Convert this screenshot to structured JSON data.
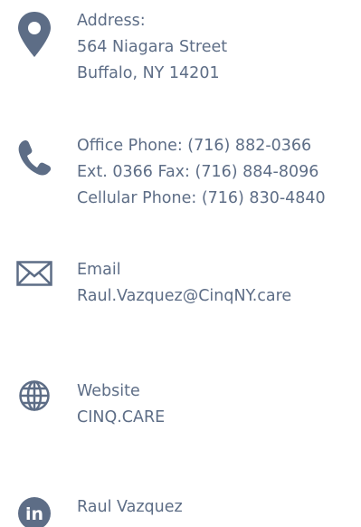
{
  "colors": {
    "icon": "#5d6d86",
    "text": "#5d6d86",
    "background": "#ffffff"
  },
  "address": {
    "icon": "map-pin-icon",
    "label": "Address:",
    "street": "564 Niagara Street",
    "city": "Buffalo, NY 14201"
  },
  "phone": {
    "icon": "phone-icon",
    "line1": "Office Phone: (716) 882-0366",
    "line2": "Ext. 0366 Fax: (716) 884-8096",
    "line3": "Cellular Phone: (716) 830-4840"
  },
  "email": {
    "icon": "envelope-icon",
    "label": "Email",
    "value": "Raul.Vazquez@CinqNY.care"
  },
  "website": {
    "icon": "globe-icon",
    "label": "Website",
    "value": "CINQ.CARE"
  },
  "linkedin": {
    "icon": "linkedin-icon",
    "icon_text": "in",
    "name": "Raul Vazquez"
  }
}
